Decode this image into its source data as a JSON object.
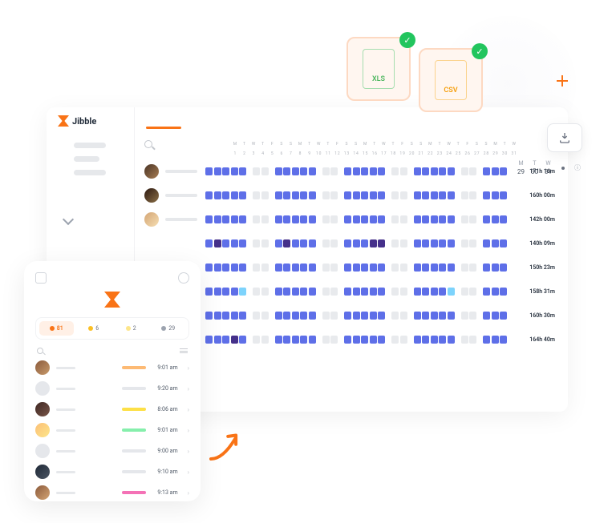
{
  "brand": {
    "name": "Jibble"
  },
  "export": {
    "xls_label": "XLS",
    "csv_label": "CSV"
  },
  "header_days": {
    "d1": {
      "label": "M",
      "num": "29"
    },
    "d2": {
      "label": "T",
      "num": "30"
    },
    "d3": {
      "label": "W",
      "num": "31"
    }
  },
  "day_letters": [
    "M",
    "T",
    "W",
    "T",
    "F",
    "S",
    "S",
    "M",
    "T",
    "W",
    "T",
    "F",
    "S",
    "S",
    "M",
    "T",
    "W",
    "T",
    "F",
    "S",
    "S",
    "M",
    "T",
    "W",
    "T",
    "F",
    "S",
    "S",
    "M",
    "T",
    "W"
  ],
  "day_nums": [
    "1",
    "2",
    "3",
    "4",
    "5",
    "6",
    "7",
    "8",
    "9",
    "10",
    "11",
    "12",
    "13",
    "14",
    "15",
    "16",
    "17",
    "18",
    "19",
    "20",
    "21",
    "22",
    "23",
    "24",
    "25",
    "26",
    "27",
    "28",
    "29",
    "30",
    "31"
  ],
  "rows": [
    {
      "total": "171h 16m"
    },
    {
      "total": "160h 00m"
    },
    {
      "total": "142h 00m"
    },
    {
      "total": "140h 09m"
    },
    {
      "total": "150h 23m"
    },
    {
      "total": "158h 31m"
    },
    {
      "total": "160h 30m"
    },
    {
      "total": "164h 40m"
    }
  ],
  "mobile": {
    "chips": {
      "a": "81",
      "b": "6",
      "c": "2",
      "d": "29"
    },
    "rows": [
      {
        "time": "9:01 am"
      },
      {
        "time": "9:20 am"
      },
      {
        "time": "8:06 am"
      },
      {
        "time": "9:01 am"
      },
      {
        "time": "9:00 am"
      },
      {
        "time": "9:10 am"
      },
      {
        "time": "9:13 am"
      }
    ]
  }
}
